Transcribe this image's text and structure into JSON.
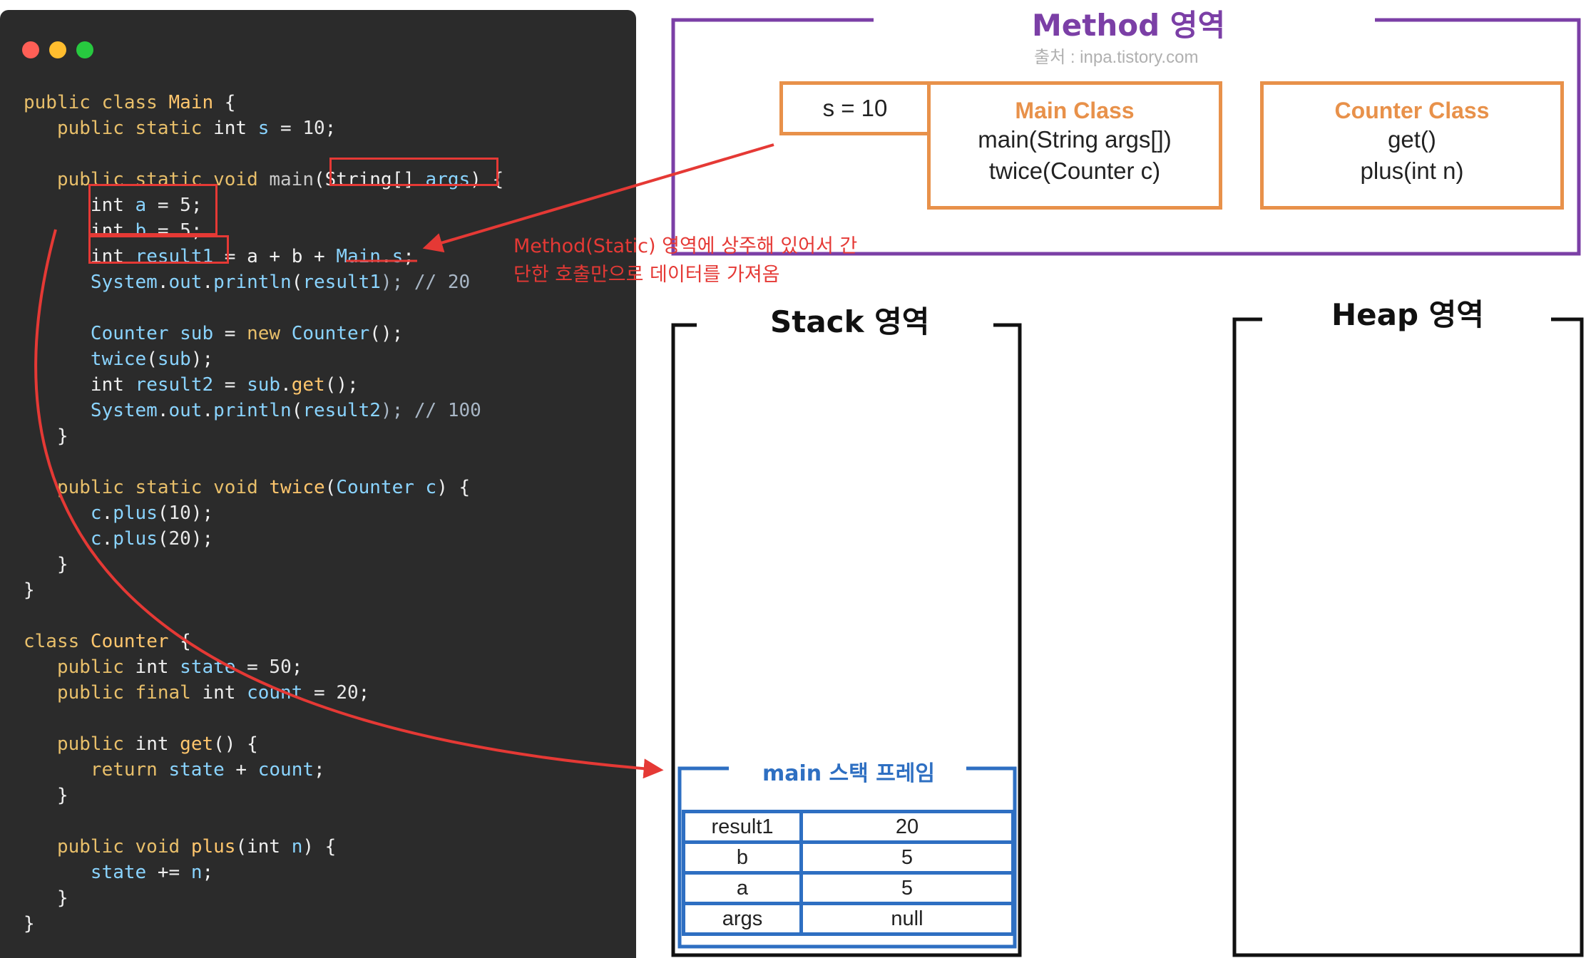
{
  "window_controls": [
    "close-button",
    "minimize-button",
    "maximize-button"
  ],
  "code_lines": [
    [
      {
        "t": "public class ",
        "c": "k"
      },
      {
        "t": "Main",
        "c": "c"
      },
      {
        "t": " {",
        "c": "t"
      }
    ],
    [
      {
        "t": "   public static ",
        "c": "k"
      },
      {
        "t": "int ",
        "c": "t"
      },
      {
        "t": "s",
        "c": "f"
      },
      {
        "t": " = ",
        "c": "t"
      },
      {
        "t": "10",
        "c": "n"
      },
      {
        "t": ";",
        "c": "t"
      }
    ],
    [],
    [
      {
        "t": "   public static void ",
        "c": "k"
      },
      {
        "t": "main",
        "c": "m"
      },
      {
        "t": "(",
        "c": "t"
      },
      {
        "t": "String[] ",
        "c": "t"
      },
      {
        "t": "args",
        "c": "f"
      },
      {
        "t": ") {",
        "c": "t"
      }
    ],
    [
      {
        "t": "      int ",
        "c": "t"
      },
      {
        "t": "a",
        "c": "f"
      },
      {
        "t": " = ",
        "c": "t"
      },
      {
        "t": "5",
        "c": "n"
      },
      {
        "t": ";",
        "c": "t"
      }
    ],
    [
      {
        "t": "      int ",
        "c": "t"
      },
      {
        "t": "b",
        "c": "f"
      },
      {
        "t": " = ",
        "c": "t"
      },
      {
        "t": "5",
        "c": "n"
      },
      {
        "t": ";",
        "c": "t"
      }
    ],
    [
      {
        "t": "      int ",
        "c": "t"
      },
      {
        "t": "result1",
        "c": "f"
      },
      {
        "t": " = a + b + ",
        "c": "t"
      },
      {
        "t": "Main",
        "c": "f"
      },
      {
        "t": ".",
        "c": "t"
      },
      {
        "t": "s",
        "c": "f"
      },
      {
        "t": ";",
        "c": "t"
      }
    ],
    [
      {
        "t": "      System",
        "c": "f"
      },
      {
        "t": ".",
        "c": "t"
      },
      {
        "t": "out",
        "c": "f"
      },
      {
        "t": ".",
        "c": "t"
      },
      {
        "t": "println",
        "c": "f"
      },
      {
        "t": "(",
        "c": "t"
      },
      {
        "t": "result1",
        "c": "f"
      },
      {
        "t": "); // 20",
        "c": "s"
      }
    ],
    [],
    [
      {
        "t": "      Counter ",
        "c": "f"
      },
      {
        "t": "sub",
        "c": "f"
      },
      {
        "t": " = ",
        "c": "t"
      },
      {
        "t": "new ",
        "c": "k"
      },
      {
        "t": "Counter",
        "c": "f"
      },
      {
        "t": "();",
        "c": "t"
      }
    ],
    [
      {
        "t": "      twice",
        "c": "f"
      },
      {
        "t": "(",
        "c": "t"
      },
      {
        "t": "sub",
        "c": "f"
      },
      {
        "t": ");",
        "c": "t"
      }
    ],
    [
      {
        "t": "      int ",
        "c": "t"
      },
      {
        "t": "result2",
        "c": "f"
      },
      {
        "t": " = ",
        "c": "t"
      },
      {
        "t": "sub",
        "c": "f"
      },
      {
        "t": ".",
        "c": "t"
      },
      {
        "t": "get",
        "c": "c"
      },
      {
        "t": "();",
        "c": "t"
      }
    ],
    [
      {
        "t": "      System",
        "c": "f"
      },
      {
        "t": ".",
        "c": "t"
      },
      {
        "t": "out",
        "c": "f"
      },
      {
        "t": ".",
        "c": "t"
      },
      {
        "t": "println",
        "c": "f"
      },
      {
        "t": "(",
        "c": "t"
      },
      {
        "t": "result2",
        "c": "f"
      },
      {
        "t": "); // 100",
        "c": "s"
      }
    ],
    [
      {
        "t": "   }",
        "c": "t"
      }
    ],
    [],
    [
      {
        "t": "   public static void ",
        "c": "k"
      },
      {
        "t": "twice",
        "c": "c"
      },
      {
        "t": "(",
        "c": "t"
      },
      {
        "t": "Counter ",
        "c": "f"
      },
      {
        "t": "c",
        "c": "f"
      },
      {
        "t": ") {",
        "c": "t"
      }
    ],
    [
      {
        "t": "      c",
        "c": "f"
      },
      {
        "t": ".",
        "c": "t"
      },
      {
        "t": "plus",
        "c": "f"
      },
      {
        "t": "(",
        "c": "t"
      },
      {
        "t": "10",
        "c": "n"
      },
      {
        "t": ");",
        "c": "t"
      }
    ],
    [
      {
        "t": "      c",
        "c": "f"
      },
      {
        "t": ".",
        "c": "t"
      },
      {
        "t": "plus",
        "c": "f"
      },
      {
        "t": "(",
        "c": "t"
      },
      {
        "t": "20",
        "c": "n"
      },
      {
        "t": ");",
        "c": "t"
      }
    ],
    [
      {
        "t": "   }",
        "c": "t"
      }
    ],
    [
      {
        "t": "}",
        "c": "t"
      }
    ],
    [],
    [
      {
        "t": "class ",
        "c": "k"
      },
      {
        "t": "Counter",
        "c": "c"
      },
      {
        "t": " {",
        "c": "t"
      }
    ],
    [
      {
        "t": "   public ",
        "c": "k"
      },
      {
        "t": "int ",
        "c": "t"
      },
      {
        "t": "state",
        "c": "f"
      },
      {
        "t": " = ",
        "c": "t"
      },
      {
        "t": "50",
        "c": "n"
      },
      {
        "t": ";",
        "c": "t"
      }
    ],
    [
      {
        "t": "   public final ",
        "c": "k"
      },
      {
        "t": "int ",
        "c": "t"
      },
      {
        "t": "count",
        "c": "f"
      },
      {
        "t": " = ",
        "c": "t"
      },
      {
        "t": "20",
        "c": "n"
      },
      {
        "t": ";",
        "c": "t"
      }
    ],
    [],
    [
      {
        "t": "   public ",
        "c": "k"
      },
      {
        "t": "int ",
        "c": "t"
      },
      {
        "t": "get",
        "c": "c"
      },
      {
        "t": "() {",
        "c": "t"
      }
    ],
    [
      {
        "t": "      return ",
        "c": "k"
      },
      {
        "t": "state",
        "c": "f"
      },
      {
        "t": " + ",
        "c": "t"
      },
      {
        "t": "count",
        "c": "f"
      },
      {
        "t": ";",
        "c": "t"
      }
    ],
    [
      {
        "t": "   }",
        "c": "t"
      }
    ],
    [],
    [
      {
        "t": "   public void ",
        "c": "k"
      },
      {
        "t": "plus",
        "c": "c"
      },
      {
        "t": "(",
        "c": "t"
      },
      {
        "t": "int ",
        "c": "t"
      },
      {
        "t": "n",
        "c": "f"
      },
      {
        "t": ") {",
        "c": "t"
      }
    ],
    [
      {
        "t": "      state",
        "c": "f"
      },
      {
        "t": " += ",
        "c": "t"
      },
      {
        "t": "n",
        "c": "f"
      },
      {
        "t": ";",
        "c": "t"
      }
    ],
    [
      {
        "t": "   }",
        "c": "t"
      }
    ],
    [
      {
        "t": "}",
        "c": "t"
      }
    ]
  ],
  "method_area": {
    "title": "Method 영역",
    "source": "출처 : inpa.tistory.com",
    "static_var": "s = 10",
    "main_class": {
      "name": "Main Class",
      "members": [
        "main(String args[])",
        "twice(Counter c)"
      ]
    },
    "counter_class": {
      "name": "Counter Class",
      "members": [
        "get()",
        "plus(int n)"
      ]
    }
  },
  "annotation": {
    "line1": "Method(Static) 영역에 상주해 있어서 간",
    "line2": "단한 호출만으로 데이터를 가져옴"
  },
  "stack_area": {
    "title": "Stack 영역",
    "frame_title": "main 스택 프레임",
    "rows": [
      {
        "name": "result1",
        "value": "20"
      },
      {
        "name": "b",
        "value": "5"
      },
      {
        "name": "a",
        "value": "5"
      },
      {
        "name": "args",
        "value": "null"
      }
    ]
  },
  "heap_area": {
    "title": "Heap 영역"
  },
  "colors": {
    "method_border": "#7b3fa6",
    "class_box": "#e8914a",
    "frame_blue": "#2e6fc2",
    "arrow_red": "#e53935",
    "editor_bg": "#2b2b2b"
  }
}
